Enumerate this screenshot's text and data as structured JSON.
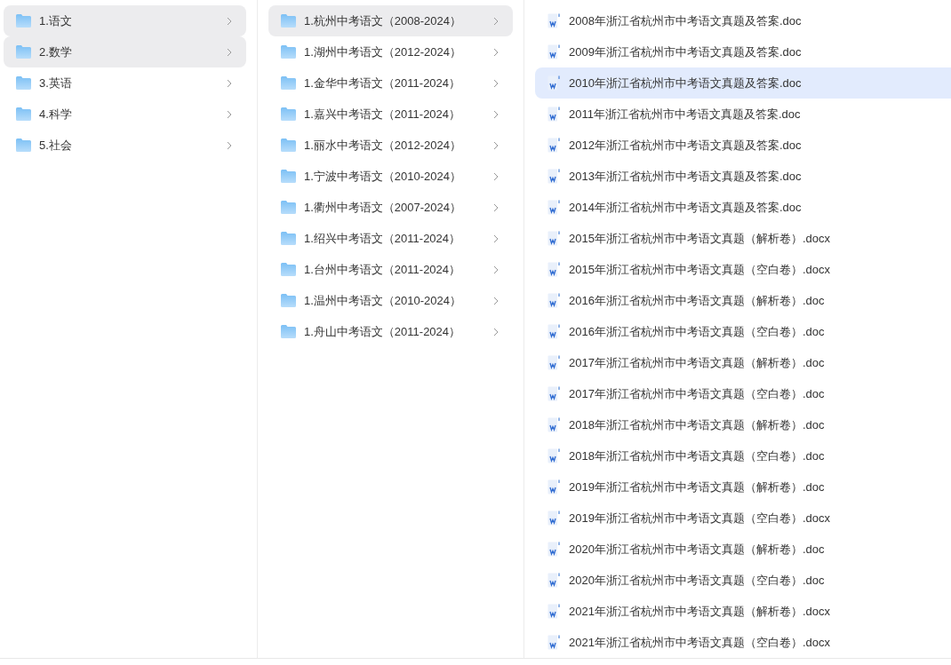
{
  "subjects": [
    {
      "label": "1.语文",
      "selected": true
    },
    {
      "label": "2.数学",
      "selected": true
    },
    {
      "label": "3.英语",
      "selected": false
    },
    {
      "label": "4.科学",
      "selected": false
    },
    {
      "label": "5.社会",
      "selected": false
    }
  ],
  "folders": [
    {
      "label": "1.杭州中考语文（2008-2024）",
      "selected": true
    },
    {
      "label": "1.湖州中考语文（2012-2024）",
      "selected": false
    },
    {
      "label": "1.金华中考语文（2011-2024）",
      "selected": false
    },
    {
      "label": "1.嘉兴中考语文（2011-2024）",
      "selected": false
    },
    {
      "label": "1.丽水中考语文（2012-2024）",
      "selected": false
    },
    {
      "label": "1.宁波中考语文（2010-2024）",
      "selected": false
    },
    {
      "label": "1.衢州中考语文（2007-2024）",
      "selected": false
    },
    {
      "label": "1.绍兴中考语文（2011-2024）",
      "selected": false
    },
    {
      "label": "1.台州中考语文（2011-2024）",
      "selected": false
    },
    {
      "label": "1.温州中考语文（2010-2024）",
      "selected": false
    },
    {
      "label": "1.舟山中考语文（2011-2024）",
      "selected": false
    }
  ],
  "files": [
    {
      "label": "2008年浙江省杭州市中考语文真题及答案.doc",
      "selected": false
    },
    {
      "label": "2009年浙江省杭州市中考语文真题及答案.doc",
      "selected": false
    },
    {
      "label": "2010年浙江省杭州市中考语文真题及答案.doc",
      "selected": true
    },
    {
      "label": "2011年浙江省杭州市中考语文真题及答案.doc",
      "selected": false
    },
    {
      "label": "2012年浙江省杭州市中考语文真题及答案.doc",
      "selected": false
    },
    {
      "label": "2013年浙江省杭州市中考语文真题及答案.doc",
      "selected": false
    },
    {
      "label": "2014年浙江省杭州市中考语文真题及答案.doc",
      "selected": false
    },
    {
      "label": "2015年浙江省杭州市中考语文真题（解析卷）.docx",
      "selected": false
    },
    {
      "label": "2015年浙江省杭州市中考语文真题（空白卷）.docx",
      "selected": false
    },
    {
      "label": "2016年浙江省杭州市中考语文真题（解析卷）.doc",
      "selected": false
    },
    {
      "label": "2016年浙江省杭州市中考语文真题（空白卷）.doc",
      "selected": false
    },
    {
      "label": "2017年浙江省杭州市中考语文真题（解析卷）.doc",
      "selected": false
    },
    {
      "label": "2017年浙江省杭州市中考语文真题（空白卷）.doc",
      "selected": false
    },
    {
      "label": "2018年浙江省杭州市中考语文真题（解析卷）.doc",
      "selected": false
    },
    {
      "label": "2018年浙江省杭州市中考语文真题（空白卷）.doc",
      "selected": false
    },
    {
      "label": "2019年浙江省杭州市中考语文真题（解析卷）.doc",
      "selected": false
    },
    {
      "label": "2019年浙江省杭州市中考语文真题（空白卷）.docx",
      "selected": false
    },
    {
      "label": "2020年浙江省杭州市中考语文真题（解析卷）.doc",
      "selected": false
    },
    {
      "label": "2020年浙江省杭州市中考语文真题（空白卷）.doc",
      "selected": false
    },
    {
      "label": "2021年浙江省杭州市中考语文真题（解析卷）.docx",
      "selected": false
    },
    {
      "label": "2021年浙江省杭州市中考语文真题（空白卷）.docx",
      "selected": false
    }
  ]
}
